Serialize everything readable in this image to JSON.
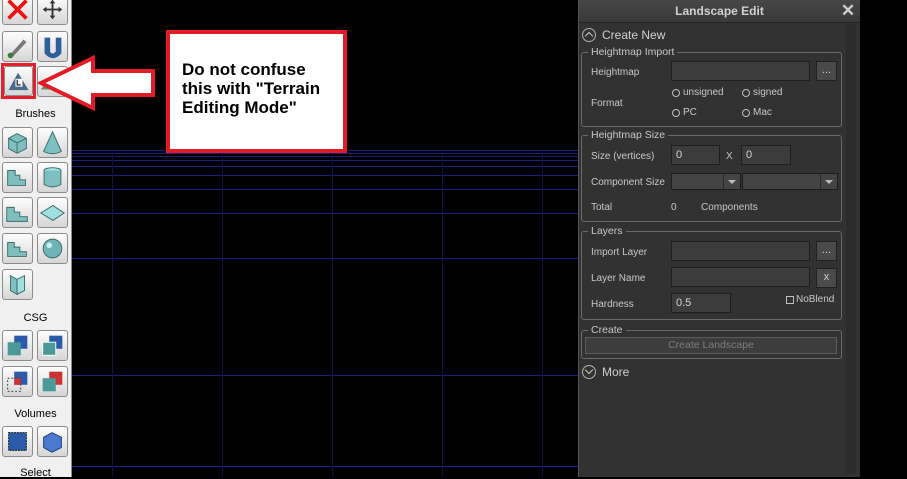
{
  "toolbox": {
    "sections": {
      "brushes": "Brushes",
      "csg": "CSG",
      "volumes": "Volumes",
      "select": "Select"
    }
  },
  "annotation": {
    "text_line1": "Do not confuse",
    "text_line2": "this with \"Terrain",
    "text_line3": "Editing Mode\""
  },
  "panel": {
    "title": "Landscape Edit",
    "close_glyph": "✕",
    "create_new": "Create New",
    "more": "More",
    "heightmap_import": {
      "group_label": "Heightmap Import",
      "heightmap_label": "Heightmap",
      "heightmap_value": "",
      "browse_label": "...",
      "format_label": "Format",
      "options": [
        "unsigned",
        "signed",
        "PC",
        "Mac"
      ]
    },
    "heightmap_size": {
      "group_label": "Heightmap Size",
      "size_label": "Size (vertices)",
      "size_x": "0",
      "x_label": "X",
      "size_y": "0",
      "component_size_label": "Component Size",
      "total_label": "Total",
      "total_value": "0",
      "total_unit": "Components"
    },
    "layers": {
      "group_label": "Layers",
      "import_layer_label": "Import Layer",
      "import_browse": "...",
      "layer_name_label": "Layer Name",
      "layer_clear": "x",
      "hardness_label": "Hardness",
      "hardness_value": "0.5",
      "noblend_label": "NoBlend"
    },
    "create": {
      "group_label": "Create",
      "button_label": "Create Landscape"
    }
  },
  "colors": {
    "panel_bg": "#323232",
    "annotation_red": "#e21b26",
    "grid_blue": "#1d1d7a"
  }
}
